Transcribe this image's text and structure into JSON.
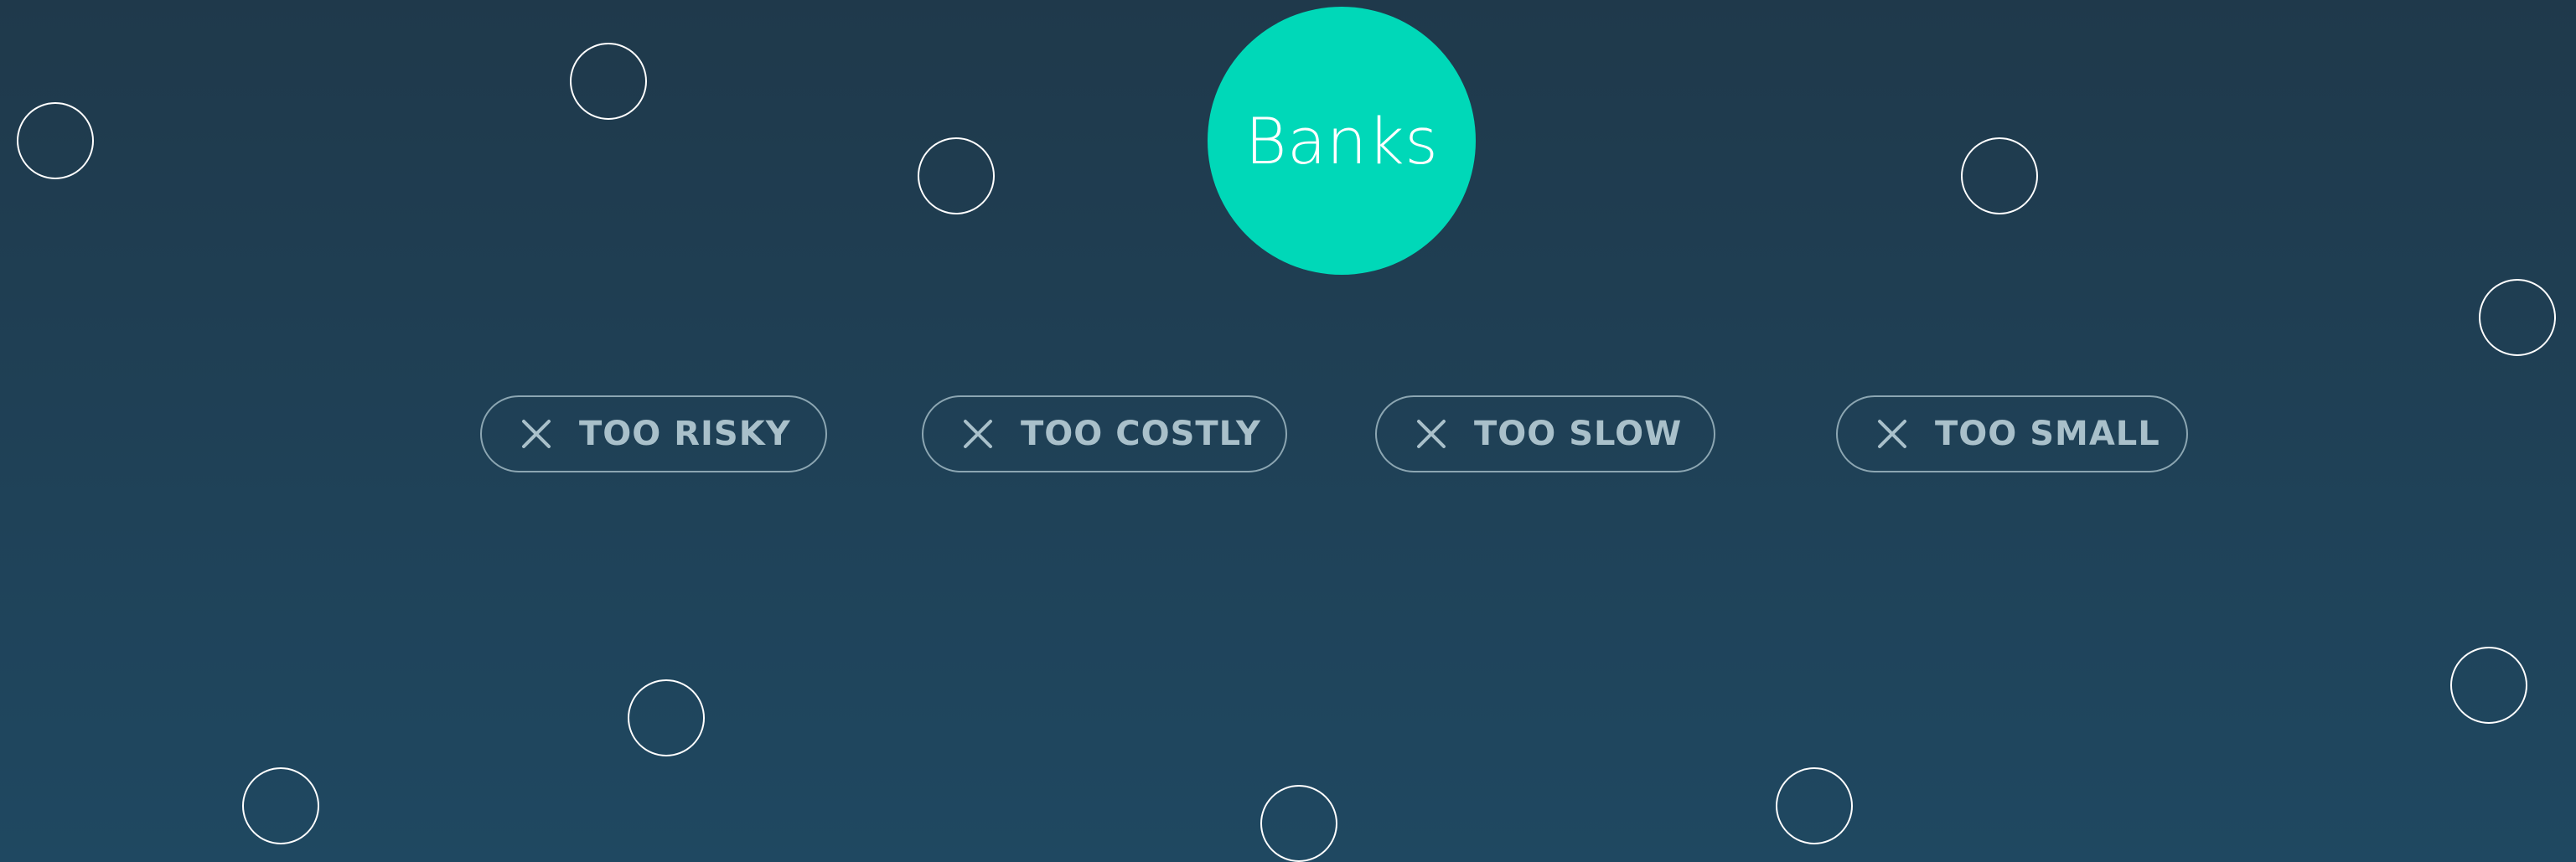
{
  "hub": {
    "label": "Banks"
  },
  "reasons": [
    {
      "label": "TOO RISKY",
      "icon": "x-icon"
    },
    {
      "label": "TOO COSTLY",
      "icon": "x-icon"
    },
    {
      "label": "TOO SLOW",
      "icon": "x-icon"
    },
    {
      "label": "TOO SMALL",
      "icon": "x-icon"
    }
  ],
  "colors": {
    "hub": "#00d8b8",
    "background_top": "#1f394b",
    "background_bottom": "#1f4861",
    "pill_border": "#8ca6b2",
    "pill_text": "#a9c0ca",
    "dot_outline": "#ffffff"
  }
}
